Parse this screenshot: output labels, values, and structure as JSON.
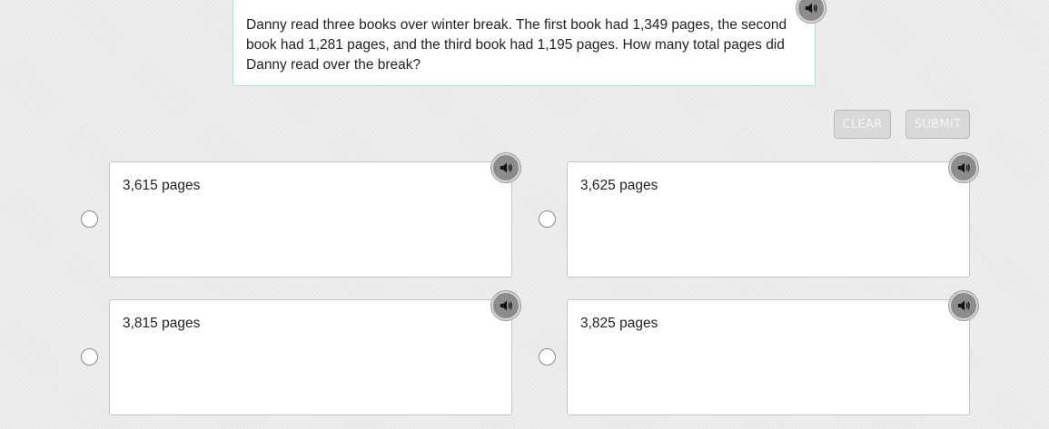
{
  "question": {
    "text": "Danny read three books over winter break. The first book had 1,349 pages, the second book had 1,281 pages, and the third book had 1,195 pages. How many total pages did Danny read over the break?",
    "audio_icon": "speaker-icon"
  },
  "actions": {
    "clear_label": "CLEAR",
    "submit_label": "SUBMIT"
  },
  "options": [
    {
      "text": "3,615 pages",
      "selected": false
    },
    {
      "text": "3,625 pages",
      "selected": false
    },
    {
      "text": "3,815 pages",
      "selected": false
    },
    {
      "text": "3,825 pages",
      "selected": false
    }
  ],
  "colors": {
    "background": "#ebebeb",
    "question_border": "#a9dbe3",
    "audio_button": "#8c8c8c",
    "disabled_button": "#d9d9d9"
  }
}
